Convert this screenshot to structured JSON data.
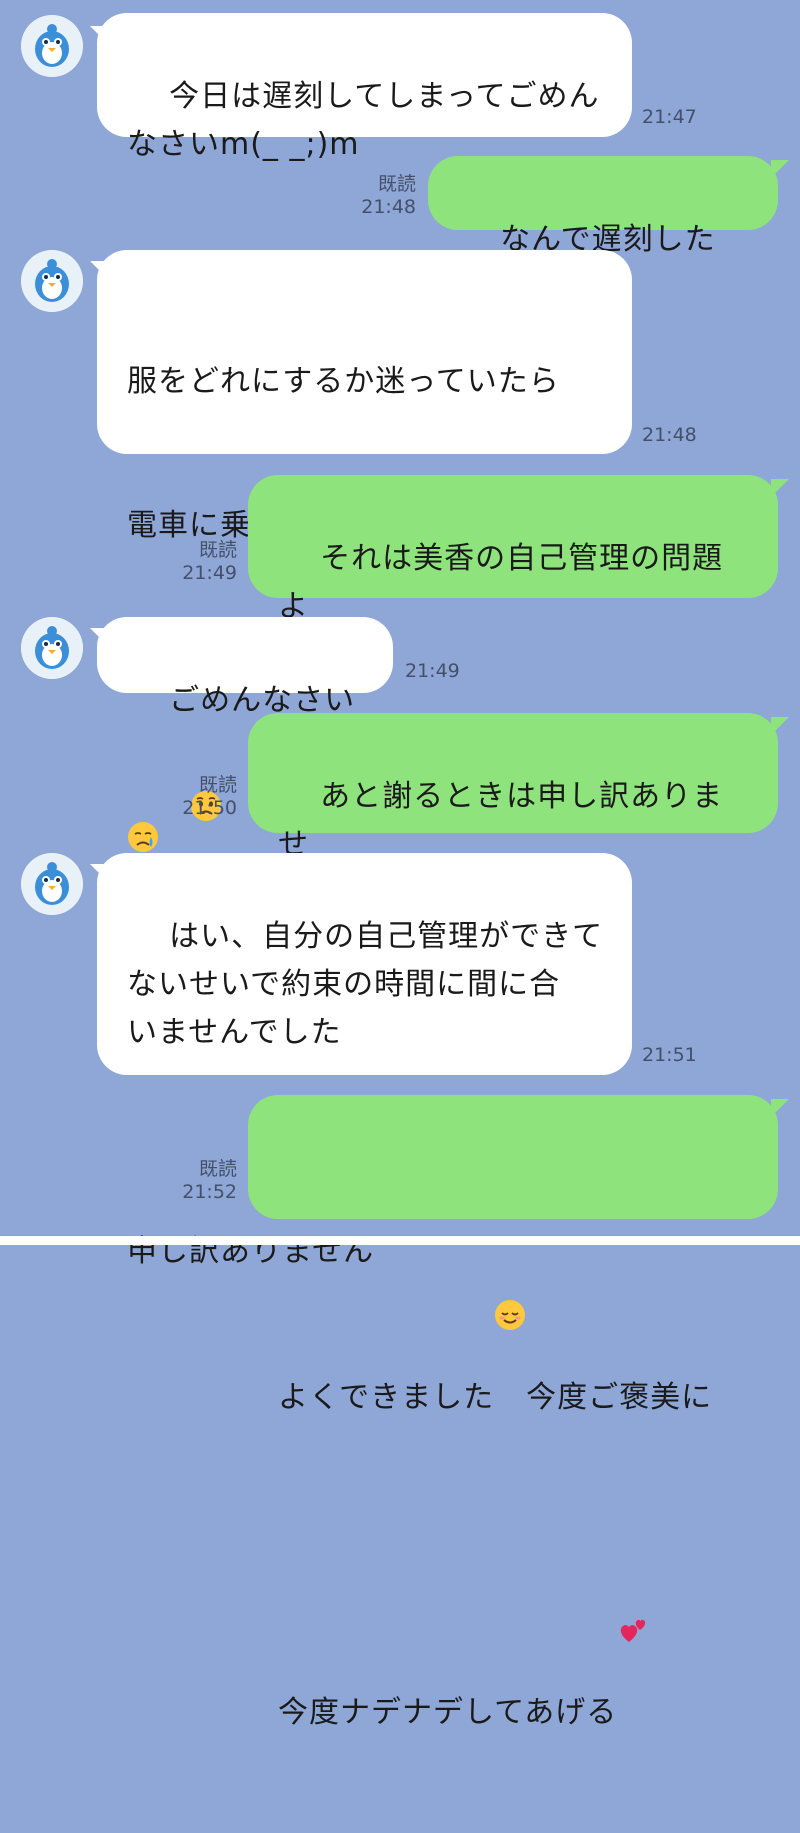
{
  "colors": {
    "background": "#8fa7d6",
    "incoming_bubble": "#ffffff",
    "outgoing_bubble": "#8ee37d",
    "meta_text": "#44506a"
  },
  "messages": [
    {
      "direction": "incoming",
      "text": "今日は遅刻してしまってごめん\nなさいm(_ _;)m",
      "time": "21:47"
    },
    {
      "direction": "outgoing",
      "text": "なんで遅刻したの？",
      "read": "既読",
      "time": "21:48"
    },
    {
      "direction": "incoming",
      "text_line1": "服をどれにするか迷っていたら",
      "text_line2": "電車に乗り遅れちゃったんです",
      "emoji": "worried-face-emoji",
      "time": "21:48"
    },
    {
      "direction": "outgoing",
      "text": "それは美香の自己管理の問題よ\nね？",
      "read": "既読",
      "time": "21:49"
    },
    {
      "direction": "incoming",
      "text": "ごめんなさい",
      "emoji": "crying-face-emoji",
      "time": "21:49"
    },
    {
      "direction": "outgoing",
      "text": "あと謝るときは申し訳ありませ\nん、ね",
      "read": "既読",
      "time": "21:50"
    },
    {
      "direction": "incoming",
      "text": "はい、自分の自己管理ができて\nないせいで約束の時間に間に合\nいませんでした\n申し訳ありません",
      "emoji": "crying-face-emoji",
      "time": "21:51"
    },
    {
      "direction": "outgoing",
      "text_part1": "よくできました",
      "emoji1": "relieved-face-emoji",
      "text_part2": "今度ご褒美に",
      "text_line2": "今度ナデナデしてあげる",
      "emoji2": "two-hearts-emoji",
      "read": "既読",
      "time": "21:52"
    }
  ]
}
